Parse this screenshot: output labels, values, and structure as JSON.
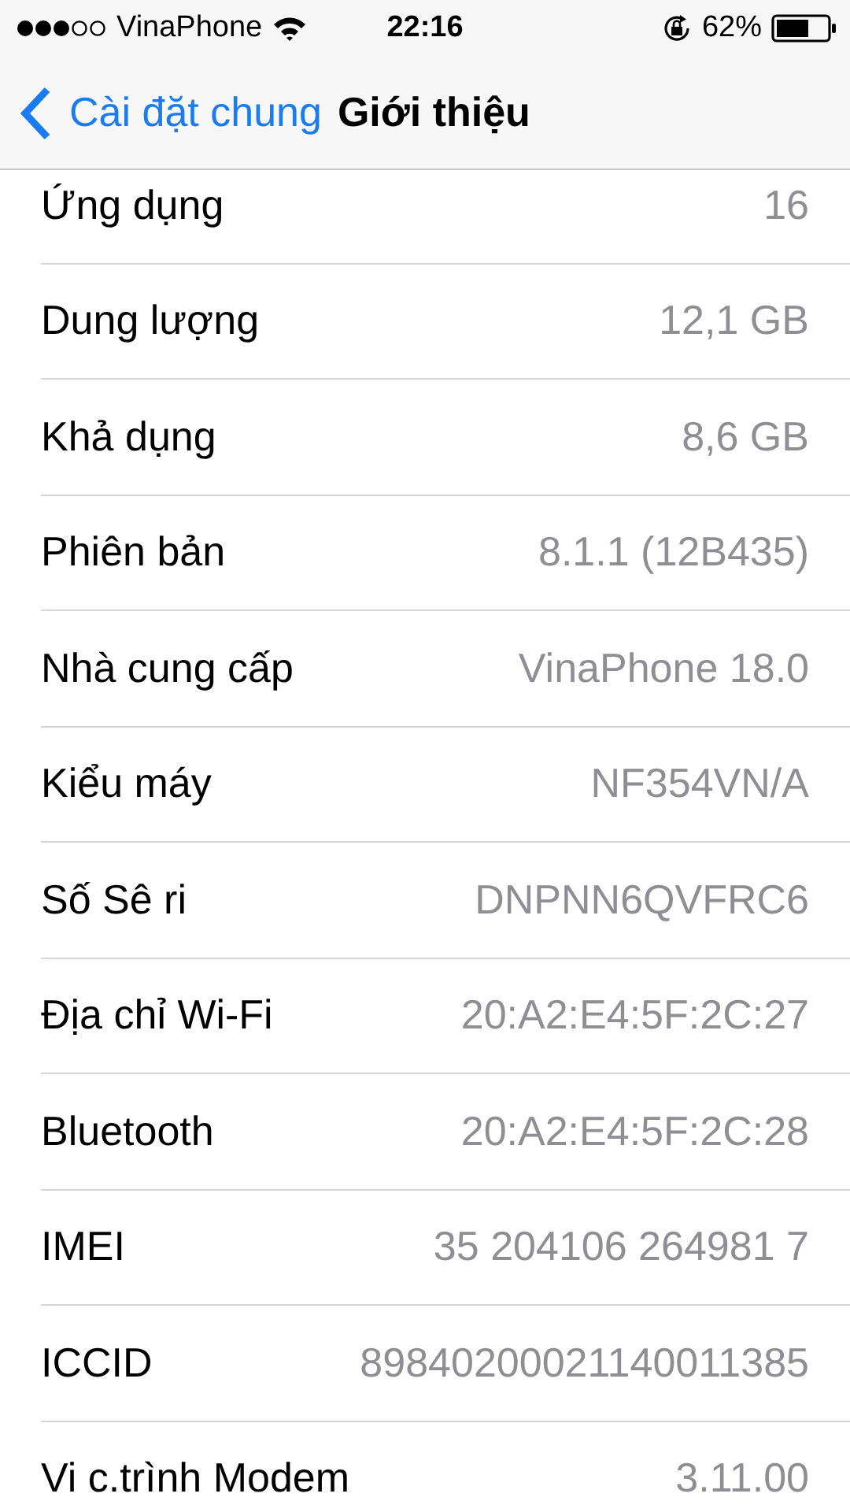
{
  "status_bar": {
    "carrier": "VinaPhone",
    "time": "22:16",
    "battery_percent": "62%"
  },
  "nav_bar": {
    "back_label": "Cài đặt chung",
    "title": "Giới thiệu"
  },
  "rows": [
    {
      "label": "Ứng dụng",
      "value": "16"
    },
    {
      "label": "Dung lượng",
      "value": "12,1 GB"
    },
    {
      "label": "Khả dụng",
      "value": "8,6 GB"
    },
    {
      "label": "Phiên bản",
      "value": "8.1.1 (12B435)"
    },
    {
      "label": "Nhà cung cấp",
      "value": "VinaPhone 18.0"
    },
    {
      "label": "Kiểu máy",
      "value": "NF354VN/A"
    },
    {
      "label": "Số Sê ri",
      "value": "DNPNN6QVFRC6"
    },
    {
      "label": "Địa chỉ Wi-Fi",
      "value": "20:A2:E4:5F:2C:27"
    },
    {
      "label": "Bluetooth",
      "value": "20:A2:E4:5F:2C:28"
    },
    {
      "label": "IMEI",
      "value": "35 204106 264981 7"
    },
    {
      "label": "ICCID",
      "value": "89840200021140011385"
    },
    {
      "label": "Vi c.trình Modem",
      "value": "3.11.00"
    }
  ]
}
